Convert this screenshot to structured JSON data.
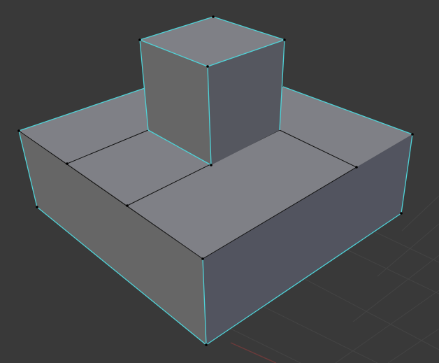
{
  "viewport": {
    "mode": "3d-viewport",
    "object_type": "mesh",
    "shading": "solid"
  },
  "colors": {
    "background": "#393939",
    "grid_line": "#444444",
    "grid_axis_x": "#6a3a3a",
    "face_top": "#7f8086",
    "face_left": "#666666",
    "face_right": "#52545f",
    "cube_front_left": "#666666",
    "cube_front_right": "#55575f",
    "cube_top": "#7f8086",
    "edge_selected": "#4fd3d8",
    "edge_wire": "#111111",
    "vertex": "#000000"
  }
}
